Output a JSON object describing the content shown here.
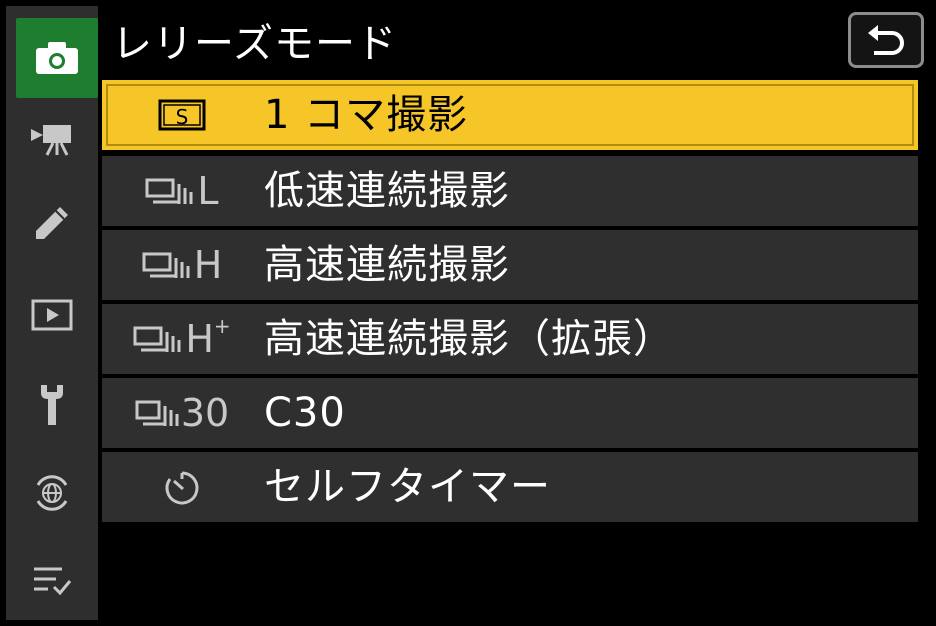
{
  "screen": {
    "title": "レリーズモード",
    "back_icon": "return-arrow-icon"
  },
  "sidebar": {
    "items": [
      {
        "icon": "camera-icon",
        "active": true
      },
      {
        "icon": "movie-camera-icon",
        "active": false
      },
      {
        "icon": "pencil-icon",
        "active": false
      },
      {
        "icon": "playback-icon",
        "active": false
      },
      {
        "icon": "wrench-icon",
        "active": false
      },
      {
        "icon": "network-globe-icon",
        "active": false
      },
      {
        "icon": "my-menu-icon",
        "active": false
      }
    ]
  },
  "menu": {
    "items": [
      {
        "icon": "single-frame-icon",
        "icon_text": "S",
        "label": "1 コマ撮影",
        "selected": true
      },
      {
        "icon": "continuous-low-icon",
        "icon_text": "L",
        "label": "低速連続撮影",
        "selected": false
      },
      {
        "icon": "continuous-high-icon",
        "icon_text": "H",
        "label": "高速連続撮影",
        "selected": false
      },
      {
        "icon": "continuous-high-extended-icon",
        "icon_text": "H",
        "icon_sup": "+",
        "label": "高速連続撮影（拡張）",
        "selected": false
      },
      {
        "icon": "c30-icon",
        "icon_text": "30",
        "label": "C30",
        "selected": false
      },
      {
        "icon": "self-timer-icon",
        "label": "セルフタイマー",
        "selected": false
      }
    ]
  },
  "colors": {
    "selected": "#f6c629",
    "active_tab": "#1e7d2e",
    "row_bg": "#2f2f2f",
    "sidebar_bg": "#2e2e2e"
  }
}
